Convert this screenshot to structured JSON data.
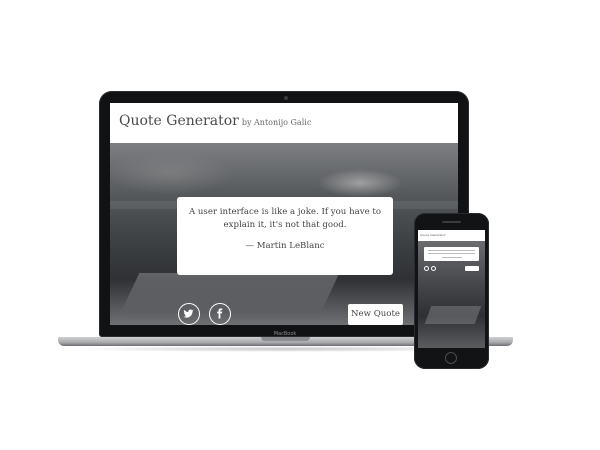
{
  "app": {
    "title": "Quote Generator",
    "byline": "by Antonijo Galic"
  },
  "quote": {
    "text": "A user interface is like a joke. If you have to explain it, it's not that good.",
    "author": "— Martin LeBlanc"
  },
  "actions": {
    "new_quote_label": "New Quote",
    "share_icons": [
      "twitter-icon",
      "facebook-icon"
    ]
  },
  "device": {
    "laptop_brand": "MacBook"
  },
  "colors": {
    "card_background": "#ffffff",
    "text": "#444444",
    "device_frame": "#111214"
  }
}
